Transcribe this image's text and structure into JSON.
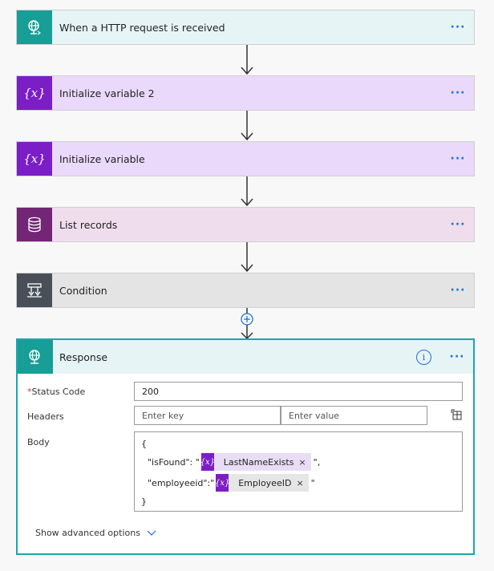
{
  "steps": {
    "http": {
      "label": "When a HTTP request is received",
      "icon": "globe-request-icon"
    },
    "var2": {
      "label": "Initialize variable 2",
      "icon": "variable-icon"
    },
    "var1": {
      "label": "Initialize variable",
      "icon": "variable-icon"
    },
    "list": {
      "label": "List records",
      "icon": "database-icon"
    },
    "cond": {
      "label": "Condition",
      "icon": "condition-icon"
    },
    "more_label": "···"
  },
  "variable_glyph": "{x}",
  "response": {
    "title": "Response",
    "info_glyph": "i",
    "more_label": "···",
    "status_code_label": "Status Code",
    "required_mark": "*",
    "status_code_value": "200",
    "headers_label": "Headers",
    "key_placeholder": "Enter key",
    "value_placeholder": "Enter value",
    "body_label": "Body",
    "body": {
      "open_brace": "{",
      "isfound_key": "\"isFound\": \"",
      "isfound_token": "LastNameExists",
      "isfound_suffix": "\",",
      "employeeid_key": "\"employeeid\":\"",
      "employeeid_token": "EmployeeID",
      "employeeid_suffix": "\"",
      "close_brace": "}",
      "remove_glyph": "×"
    },
    "advanced_label": "Show advanced options"
  },
  "colors": {
    "http_accent": "#179e96",
    "variable_accent": "#7b1ec6",
    "list_accent": "#722675",
    "condition_accent": "#484f58",
    "link_blue": "#1f6fd1"
  }
}
